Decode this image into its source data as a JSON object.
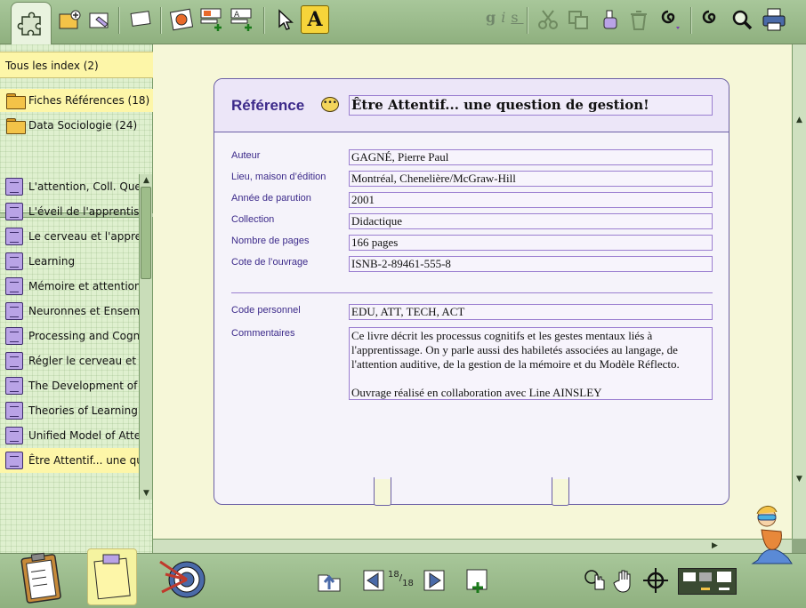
{
  "toolbar": {
    "format_letters": [
      "g",
      "i",
      "s"
    ],
    "text_tool_label": "A"
  },
  "sidebar": {
    "all_index": "Tous les index (2)",
    "folders": [
      {
        "label": "Fiches Références (18)",
        "selected": true
      },
      {
        "label": "Data Sociologie (24)",
        "selected": false
      }
    ],
    "items": [
      {
        "label": "L'attention, Coll. Que"
      },
      {
        "label": "L'éveil de l'apprentiss"
      },
      {
        "label": "Le cerveau et l'appren"
      },
      {
        "label": "Learning"
      },
      {
        "label": "Mémoire et attention"
      },
      {
        "label": "Neuronnes et Ensemb"
      },
      {
        "label": "Processing and Cogn"
      },
      {
        "label": "Régler le cerveau et a"
      },
      {
        "label": "The Development of"
      },
      {
        "label": "Theories of Learning"
      },
      {
        "label": "Unified Model of Atte"
      },
      {
        "label": "Être Attentif... une qu"
      }
    ]
  },
  "card": {
    "type_label": "Référence",
    "title": "Être Attentif... une question de gestion!",
    "fields": [
      {
        "label": "Auteur",
        "value": "GAGNÉ, Pierre Paul"
      },
      {
        "label": "Lieu, maison d’édition",
        "value": "Montréal, Chenelière/McGraw-Hill"
      },
      {
        "label": "Année de parution",
        "value": "2001"
      },
      {
        "label": "Collection",
        "value": "Didactique"
      },
      {
        "label": "Nombre de pages",
        "value": "166 pages"
      },
      {
        "label": "Cote de l’ouvrage",
        "value": "ISNB-2-89461-555-8"
      }
    ],
    "personal_code_label": "Code personnel",
    "personal_code": "EDU, ATT, TECH, ACT",
    "comments_label": "Commentaires",
    "comments_p1": "Ce livre décrit les processus cognitifs et les gestes mentaux liés à l'apprentissage. On y parle aussi des habiletés associées au langage, de l'attention auditive, de la gestion de la mémoire et du Modèle Réflecto.",
    "comments_p2": "Ouvrage réalisé en collaboration avec Line AINSLEY"
  },
  "pager": {
    "current": "18",
    "total": "18"
  },
  "colors": {
    "accent": "#3c2a8a",
    "selection": "#fdf6a8",
    "chrome": "#9dbd8d"
  }
}
